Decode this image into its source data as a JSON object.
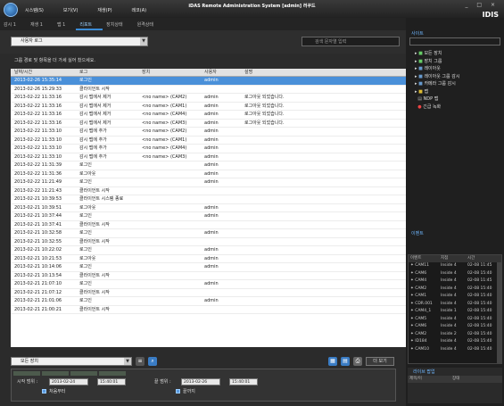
{
  "app": {
    "title": "iDAS Remote Administration System [admin] 러쿠드",
    "brand": "IDIS",
    "window_controls": "_ □ ×",
    "menu": [
      "시스템(S)",
      "보기(V)",
      "재생(P)",
      "레코(A)"
    ]
  },
  "tabs": [
    {
      "label": "감시 1",
      "active": false
    },
    {
      "label": "재생 1",
      "active": false
    },
    {
      "label": "맵 1",
      "active": false
    },
    {
      "label": "리포트",
      "active": true
    },
    {
      "label": "장치상태",
      "active": false
    },
    {
      "label": "원격상태",
      "active": false
    }
  ],
  "toolbar": {
    "log_type": "사용자 로그",
    "search_placeholder": "검색 문자열 입력",
    "hint": "그룹 경로 및 항목을 더 가세 싫어 찼으세요."
  },
  "table": {
    "columns": [
      "날짜/시간",
      "로그",
      "장치",
      "사용자",
      "설명"
    ],
    "rows": [
      [
        "2013-02-26 15:35:14",
        "로그인",
        "",
        "admin",
        ""
      ],
      [
        "2013-02-26 15:29:33",
        "클라이언트 시작",
        "",
        "",
        ""
      ],
      [
        "2013-02-22 11:33:16",
        "감시 맵에서 제거",
        "<no name> (CAM2)",
        "admin",
        "로그아웃 되었습니다."
      ],
      [
        "2013-02-22 11:33:16",
        "감시 맵에서 제거",
        "<no name> (CAM1)",
        "admin",
        "로그아웃 되었습니다."
      ],
      [
        "2013-02-22 11:33:16",
        "감시 맵에서 제거",
        "<no name> (CAM4)",
        "admin",
        "로그아웃 되었습니다."
      ],
      [
        "2013-02-22 11:33:16",
        "감시 맵에서 제거",
        "<no name> (CAM3)",
        "admin",
        "로그아웃 되었습니다."
      ],
      [
        "2013-02-22 11:33:10",
        "감시 맵에 추가",
        "<no name> (CAM2)",
        "admin",
        ""
      ],
      [
        "2013-02-22 11:33:10",
        "감시 맵에 추가",
        "<no name> (CAM1)",
        "admin",
        ""
      ],
      [
        "2013-02-22 11:33:10",
        "감시 맵에 추가",
        "<no name> (CAM4)",
        "admin",
        ""
      ],
      [
        "2013-02-22 11:33:10",
        "감시 맵에 추가",
        "<no name> (CAM3)",
        "admin",
        ""
      ],
      [
        "2013-02-22 11:31:39",
        "로그인",
        "",
        "admin",
        ""
      ],
      [
        "2013-02-22 11:31:36",
        "로그아웃",
        "",
        "admin",
        ""
      ],
      [
        "2013-02-22 11:21:49",
        "로그인",
        "",
        "admin",
        ""
      ],
      [
        "2013-02-22 11:21:43",
        "클라이언트 시작",
        "",
        "",
        ""
      ],
      [
        "2013-02-21 10:39:53",
        "클라이언트 시스템 종료",
        "",
        "",
        ""
      ],
      [
        "2013-02-21 10:39:51",
        "로그아웃",
        "",
        "admin",
        ""
      ],
      [
        "2013-02-21 10:37:44",
        "로그인",
        "",
        "admin",
        ""
      ],
      [
        "2013-02-21 10:37:41",
        "클라이언트 시작",
        "",
        "",
        ""
      ],
      [
        "2013-02-21 10:32:58",
        "로그인",
        "",
        "admin",
        ""
      ],
      [
        "2013-02-21 10:32:55",
        "클라이언트 시작",
        "",
        "",
        ""
      ],
      [
        "2013-02-21 10:22:02",
        "로그인",
        "",
        "admin",
        ""
      ],
      [
        "2013-02-21 10:21:53",
        "로그아웃",
        "",
        "admin",
        ""
      ],
      [
        "2013-02-21 10:14:06",
        "로그인",
        "",
        "admin",
        ""
      ],
      [
        "2013-02-21 10:13:54",
        "클라이언트 시작",
        "",
        "",
        ""
      ],
      [
        "2013-02-21 21:07:10",
        "로그인",
        "",
        "admin",
        ""
      ],
      [
        "2013-02-21 21:07:12",
        "클라이언트 시작",
        "",
        "",
        ""
      ],
      [
        "2013-02-21 21:01:06",
        "로그인",
        "",
        "admin",
        ""
      ],
      [
        "2013-02-21 21:00:21",
        "클라이언트 시작",
        "",
        "",
        ""
      ]
    ]
  },
  "bottom": {
    "device_filter": "모든 장치",
    "search_button": "더 보기"
  },
  "filter": {
    "start_label": "시작 범위 :",
    "end_label": "끝 범위 :",
    "start_date": "2013-02-24",
    "start_time": "15:40:01",
    "end_date": "2013-02-26",
    "end_time": "15:40:01",
    "from_start_label": "처음부터",
    "to_end_label": "끝까지"
  },
  "sidebar": {
    "header": "사이트",
    "search_placeholder": "",
    "tree": [
      "모든 장치",
      "장치 그룹",
      "레이아웃",
      "레이아웃 그룹 감시",
      "카메라 그룹 감시",
      "맵",
      "NDP 맵",
      "긴급 녹화"
    ],
    "event_header": "이벤트",
    "event_columns": [
      "이벤트",
      "지점",
      "시간"
    ],
    "events": [
      [
        "CAM11",
        "Inside 4",
        "02-08 11:45"
      ],
      [
        "CAM6",
        "Inside 4",
        "02-08 15:40"
      ],
      [
        "CAM4",
        "Inside 4",
        "02-08 11:45"
      ],
      [
        "CAM2",
        "Inside 4",
        "02-08 15:40"
      ],
      [
        "CAM1",
        "Inside 4",
        "02-08 15:40"
      ],
      [
        "CDR.001",
        "Inside 4",
        "02-08 15:40"
      ],
      [
        "CAM4_1",
        "Inside 1",
        "02-08 15:40"
      ],
      [
        "CAM5",
        "Inside 4",
        "02-08 15:40"
      ],
      [
        "CAM6",
        "Inside 4",
        "02-08 15:40"
      ],
      [
        "CAM2",
        "Inside 2",
        "02-08 15:40"
      ],
      [
        "ID184",
        "Inside 4",
        "02-08 15:40"
      ],
      [
        "CAM10",
        "Inside 4",
        "02-08 15:40"
      ]
    ],
    "detail_header": "라이브 팝업",
    "detail_columns": [
      "제목/이",
      "장태"
    ]
  },
  "colors": {
    "selection": "#4a90d9",
    "accent": "#6fb7ff"
  }
}
